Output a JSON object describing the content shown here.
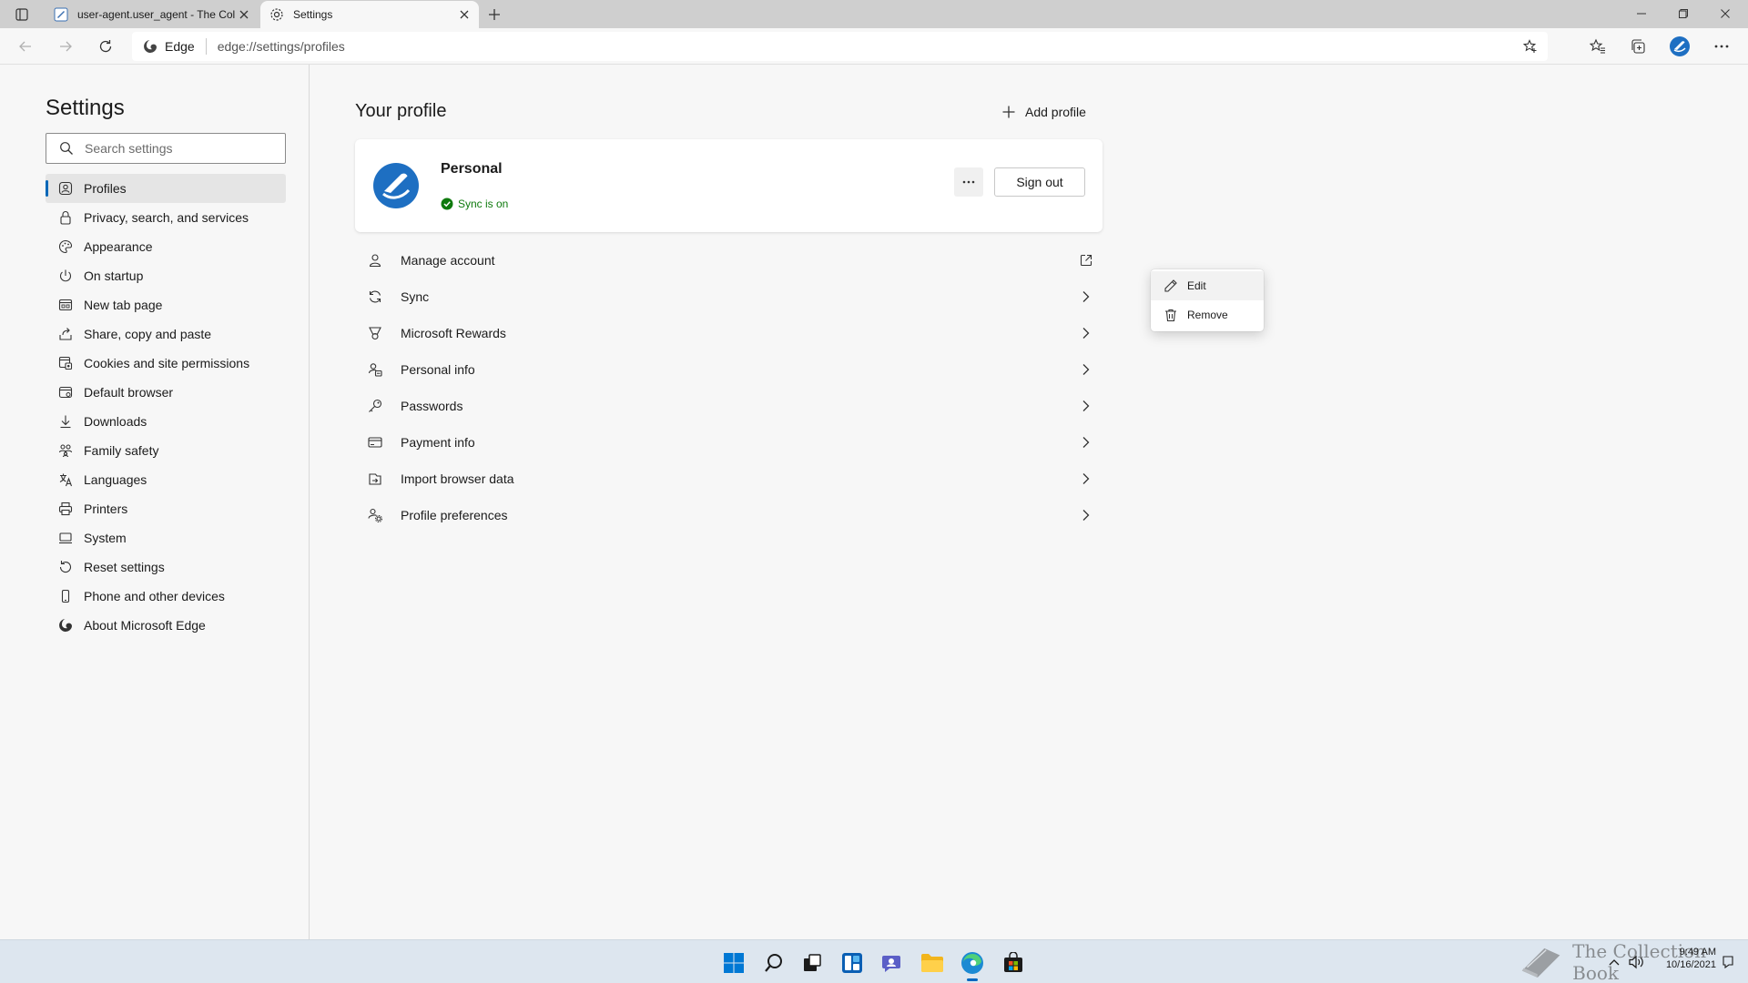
{
  "browser": {
    "tabs": [
      {
        "title": "user-agent.user_agent - The Coll",
        "active": false
      },
      {
        "title": "Settings",
        "active": true
      }
    ],
    "address": {
      "site_label": "Edge",
      "url": "edge://settings/profiles"
    }
  },
  "sidebar": {
    "title": "Settings",
    "search_placeholder": "Search settings",
    "items": [
      {
        "label": "Profiles",
        "icon": "profile-icon",
        "selected": true
      },
      {
        "label": "Privacy, search, and services",
        "icon": "lock-icon"
      },
      {
        "label": "Appearance",
        "icon": "appearance-icon"
      },
      {
        "label": "On startup",
        "icon": "power-icon"
      },
      {
        "label": "New tab page",
        "icon": "new-tab-icon"
      },
      {
        "label": "Share, copy and paste",
        "icon": "share-icon"
      },
      {
        "label": "Cookies and site permissions",
        "icon": "cookies-icon"
      },
      {
        "label": "Default browser",
        "icon": "browser-icon"
      },
      {
        "label": "Downloads",
        "icon": "download-icon"
      },
      {
        "label": "Family safety",
        "icon": "family-icon"
      },
      {
        "label": "Languages",
        "icon": "languages-icon"
      },
      {
        "label": "Printers",
        "icon": "printer-icon"
      },
      {
        "label": "System",
        "icon": "system-icon"
      },
      {
        "label": "Reset settings",
        "icon": "reset-icon"
      },
      {
        "label": "Phone and other devices",
        "icon": "phone-icon"
      },
      {
        "label": "About Microsoft Edge",
        "icon": "edge-icon"
      }
    ]
  },
  "main": {
    "title": "Your profile",
    "add_profile_label": "Add profile",
    "profile": {
      "name": "Personal",
      "sync_status": "Sync is on",
      "more_label": "···",
      "sign_out_label": "Sign out"
    },
    "context_menu": {
      "items": [
        {
          "label": "Edit",
          "icon": "pencil-icon"
        },
        {
          "label": "Remove",
          "icon": "trash-icon"
        }
      ]
    },
    "rows": [
      {
        "label": "Manage account",
        "icon": "person-icon",
        "action": "external"
      },
      {
        "label": "Sync",
        "icon": "sync-icon",
        "action": "chevron"
      },
      {
        "label": "Microsoft Rewards",
        "icon": "rewards-icon",
        "action": "chevron"
      },
      {
        "label": "Personal info",
        "icon": "personal-info-icon",
        "action": "chevron"
      },
      {
        "label": "Passwords",
        "icon": "key-icon",
        "action": "chevron"
      },
      {
        "label": "Payment info",
        "icon": "card-icon",
        "action": "chevron"
      },
      {
        "label": "Import browser data",
        "icon": "import-icon",
        "action": "chevron"
      },
      {
        "label": "Profile preferences",
        "icon": "profile-prefs-icon",
        "action": "chevron"
      }
    ]
  },
  "taskbar": {
    "time": "9:49 AM",
    "date": "10/16/2021",
    "watermark_text": "The Collection Book"
  },
  "colors": {
    "accent": "#0067b8",
    "sync_green": "#0e7a0d",
    "avatar_blue": "#1e6fc2"
  }
}
